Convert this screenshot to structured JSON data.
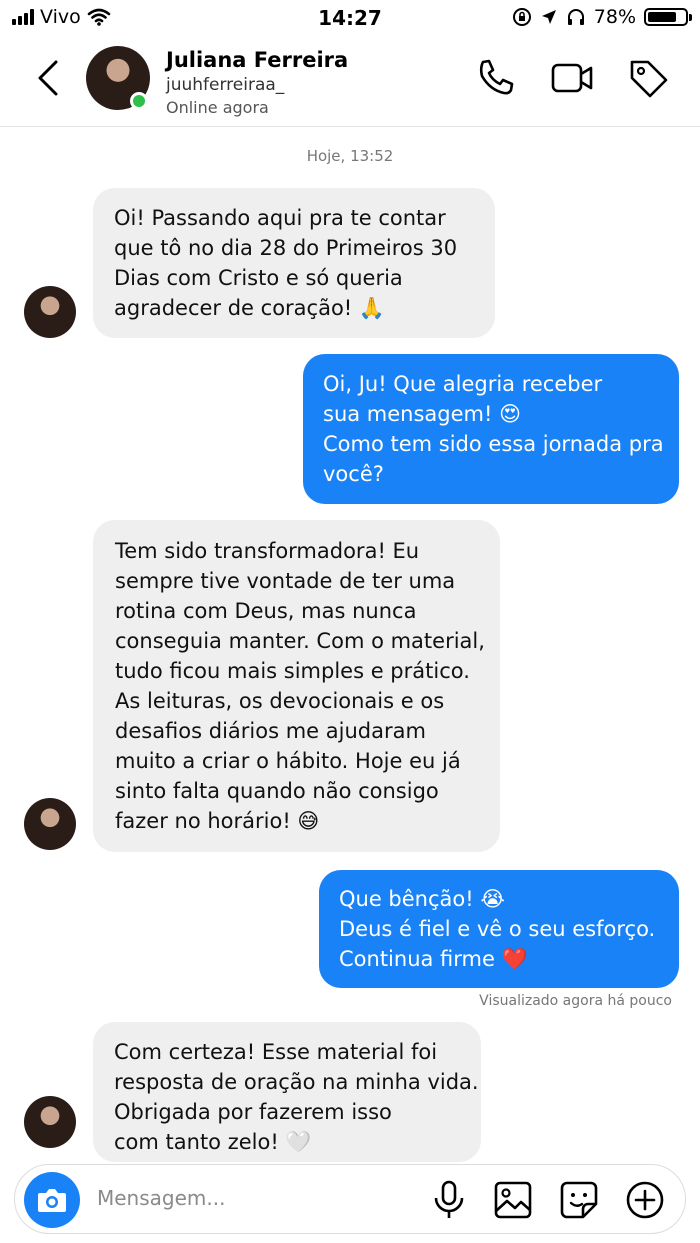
{
  "status_bar": {
    "carrier": "Vivo",
    "time": "14:27",
    "battery": "78%",
    "battery_level": 0.78
  },
  "header": {
    "name": "Juliana Ferreira",
    "username": "juuhferreiraa_",
    "status": "Online agora",
    "icons": [
      "back-icon",
      "phone-icon",
      "video-icon",
      "tag-icon"
    ]
  },
  "chat": {
    "timestamp": "Hoje, 13:52",
    "messages": [
      {
        "from": "contact",
        "lines": [
          "Oi! Passando aqui pra te contar",
          "que tô no dia 28 do Primeiros 30",
          "Dias com Cristo e só queria",
          "agradecer de coração! 🙏"
        ]
      },
      {
        "from": "me",
        "lines": [
          "Oi, Ju! Que alegria receber",
          "sua mensagem! 😍",
          "Como tem sido essa jornada pra",
          "você?"
        ]
      },
      {
        "from": "contact",
        "lines": [
          "Tem sido transformadora! Eu",
          "sempre tive vontade de ter uma",
          "rotina com Deus, mas nunca",
          "conseguia manter. Com o material,",
          "tudo ficou mais simples e prático.",
          "As leituras, os devocionais e os",
          "desafios diários me ajudaram",
          "muito a criar o hábito. Hoje eu já",
          "sinto falta quando não consigo",
          "fazer no horário! 😅"
        ]
      },
      {
        "from": "me",
        "lines": [
          "Que bênção! 😭",
          "Deus é fiel e vê o seu esforço.",
          "Continua firme ❤️"
        ]
      },
      {
        "from": "contact",
        "lines": [
          "Com certeza! Esse material foi",
          "resposta de oração na minha vida.",
          "Obrigada por fazerem isso",
          "com tanto zelo! 🤍"
        ]
      }
    ],
    "seen": "Visualizado agora há pouco"
  },
  "composer": {
    "placeholder": "Mensagem...",
    "icons": [
      "camera-icon",
      "microphone-icon",
      "gallery-icon",
      "sticker-icon",
      "plus-icon"
    ]
  },
  "colors": {
    "outgoing_bubble": "#1a82f7",
    "incoming_bubble": "#efeff0",
    "online": "#2fbf4a"
  }
}
